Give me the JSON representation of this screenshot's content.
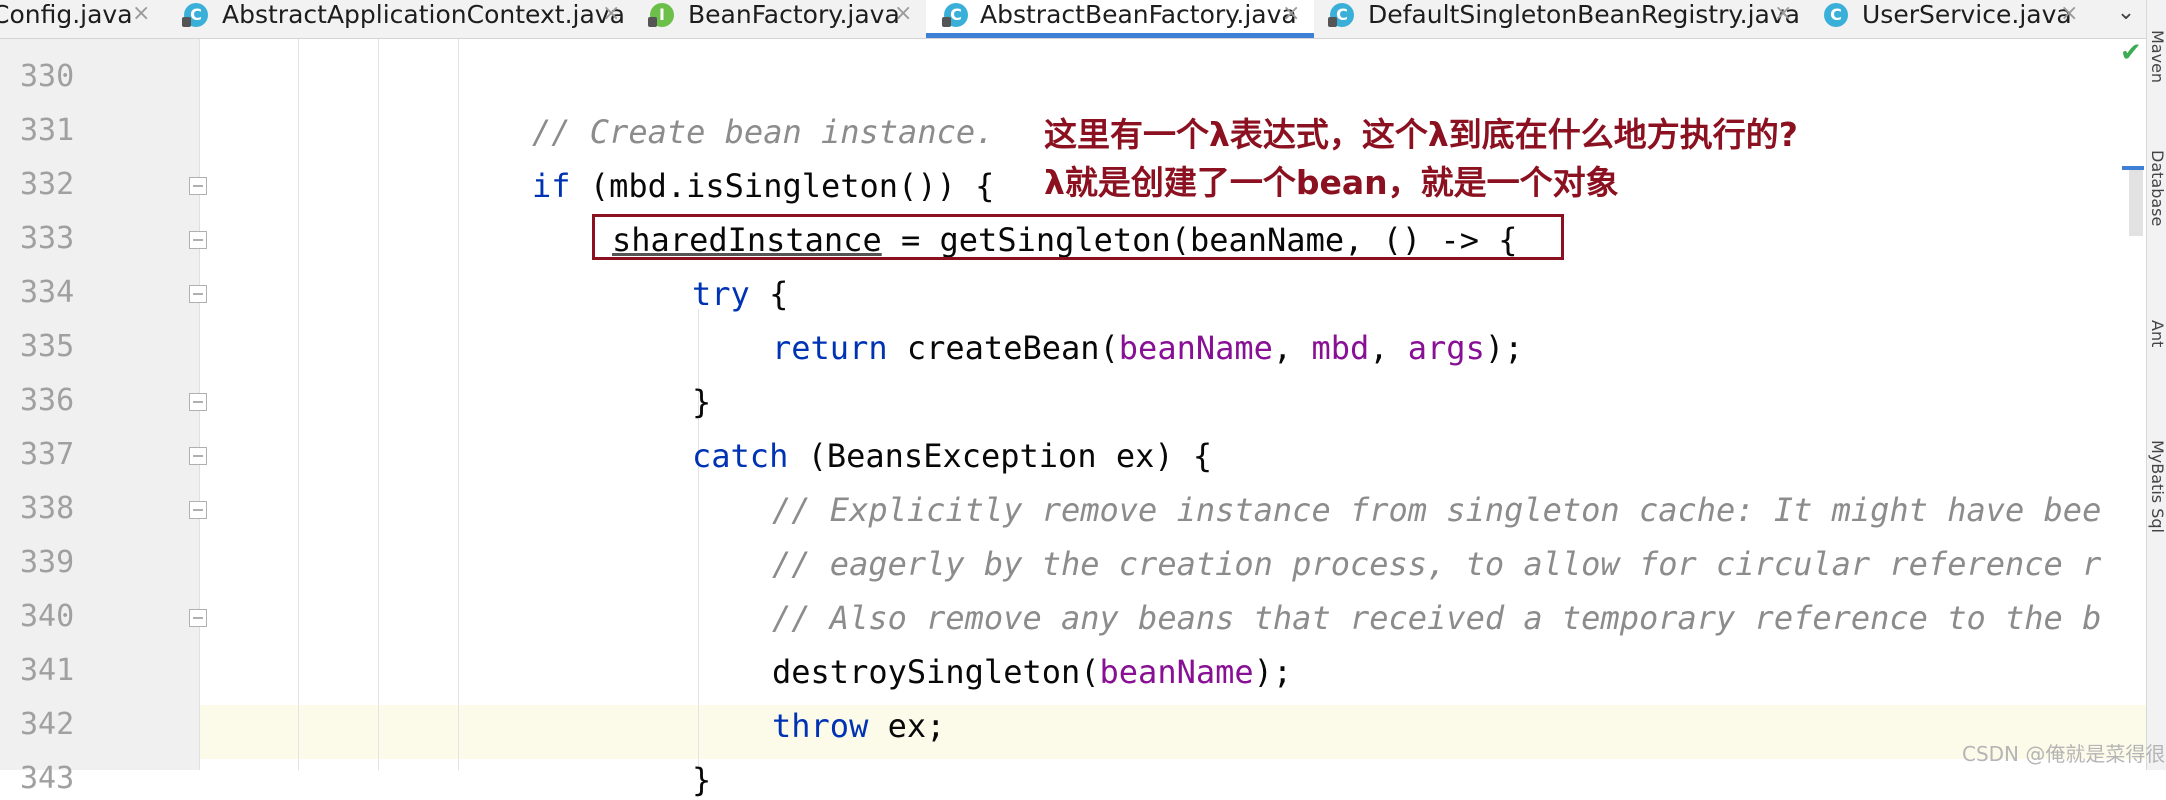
{
  "tabs": [
    {
      "label": "Config.java",
      "icon": "class-icon",
      "active": false
    },
    {
      "label": "AbstractApplicationContext.java",
      "icon": "class-icon",
      "active": false
    },
    {
      "label": "BeanFactory.java",
      "icon": "interface-icon",
      "active": false
    },
    {
      "label": "AbstractBeanFactory.java",
      "icon": "class-icon",
      "active": true
    },
    {
      "label": "DefaultSingletonBeanRegistry.java",
      "icon": "class-icon",
      "active": false
    },
    {
      "label": "UserService.java",
      "icon": "class-icon",
      "active": false
    }
  ],
  "icon_glyphs": {
    "class": "C",
    "interface": "I",
    "close": "×",
    "overflow": "⌄",
    "check": "✔"
  },
  "line_numbers": [
    "330",
    "331",
    "332",
    "333",
    "334",
    "335",
    "336",
    "337",
    "338",
    "339",
    "340",
    "341",
    "342",
    "343"
  ],
  "code": {
    "l331": "// Create bean instance.",
    "l332_kw": "if",
    "l332_rest": " (mbd.isSingleton()) {",
    "l333_var": "sharedInstance",
    "l333_rest": " = getSingleton(beanName, () -> {",
    "l334_kw": "try",
    "l334_rest": " {",
    "l335_kw": "return",
    "l335_a": " createBean(",
    "l335_p1": "beanName",
    "l335_b": ", ",
    "l335_p2": "mbd",
    "l335_c": ", ",
    "l335_p3": "args",
    "l335_d": ");",
    "l336": "}",
    "l337_kw": "catch",
    "l337_rest": " (BeansException ex) {",
    "l338": "// Explicitly remove instance from singleton cache: It might have bee",
    "l339": "// eagerly by the creation process, to allow for circular reference r",
    "l340": "// Also remove any beans that received a temporary reference to the b",
    "l341_a": "destroySingleton(",
    "l341_p": "beanName",
    "l341_b": ");",
    "l342_kw": "throw",
    "l342_rest": " ex;",
    "l343": "}"
  },
  "annotations": {
    "line1": "这里有一个λ表达式，这个λ到底在什么地方执行的?",
    "line2": "λ就是创建了一个bean，就是一个对象"
  },
  "side_tools": [
    "Maven",
    "Database",
    "Ant",
    "MyBatis Sql"
  ],
  "watermark": "CSDN @俺就是菜得很",
  "colors": {
    "keyword": "#0033b3",
    "parameter": "#871094",
    "comment": "#8c8c8c",
    "annotation": "#8b1020",
    "active_tab_underline": "#3f7fd6"
  }
}
